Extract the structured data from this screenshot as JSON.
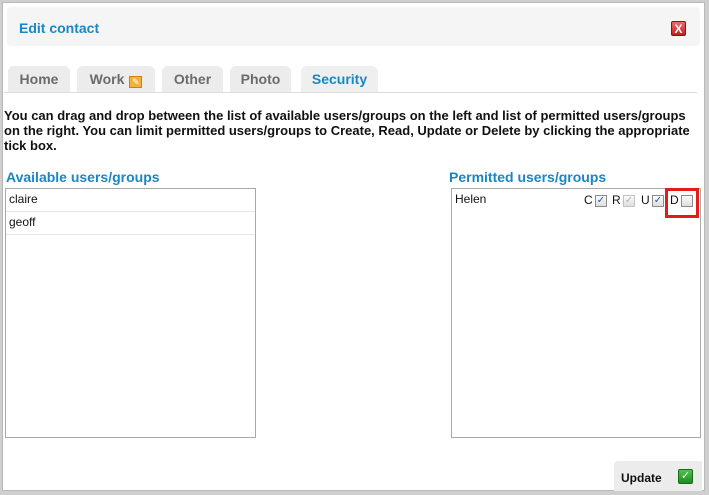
{
  "dialog": {
    "title": "Edit contact",
    "close_label": "X"
  },
  "tabs": [
    {
      "label": "Home"
    },
    {
      "label": "Work"
    },
    {
      "label": "Other"
    },
    {
      "label": "Photo"
    },
    {
      "label": "Security",
      "active": true
    }
  ],
  "description": "You can drag and drop between the list of available users/groups on the left and list of permitted users/groups on the right. You can limit permitted users/groups to Create, Read, Update or Delete by clicking the appropriate tick box.",
  "available": {
    "heading": "Available users/groups",
    "items": [
      "claire",
      "geoff"
    ]
  },
  "permitted": {
    "heading": "Permitted users/groups",
    "items": [
      {
        "name": "Helen",
        "flags": {
          "c_label": "C",
          "c_checked": true,
          "r_label": "R",
          "r_checked": true,
          "r_disabled": true,
          "u_label": "U",
          "u_checked": true,
          "d_label": "D",
          "d_checked": false
        }
      }
    ]
  },
  "footer": {
    "update_label": "Update"
  },
  "colors": {
    "accent": "#1b86c4",
    "highlight": "#e21b1b"
  }
}
